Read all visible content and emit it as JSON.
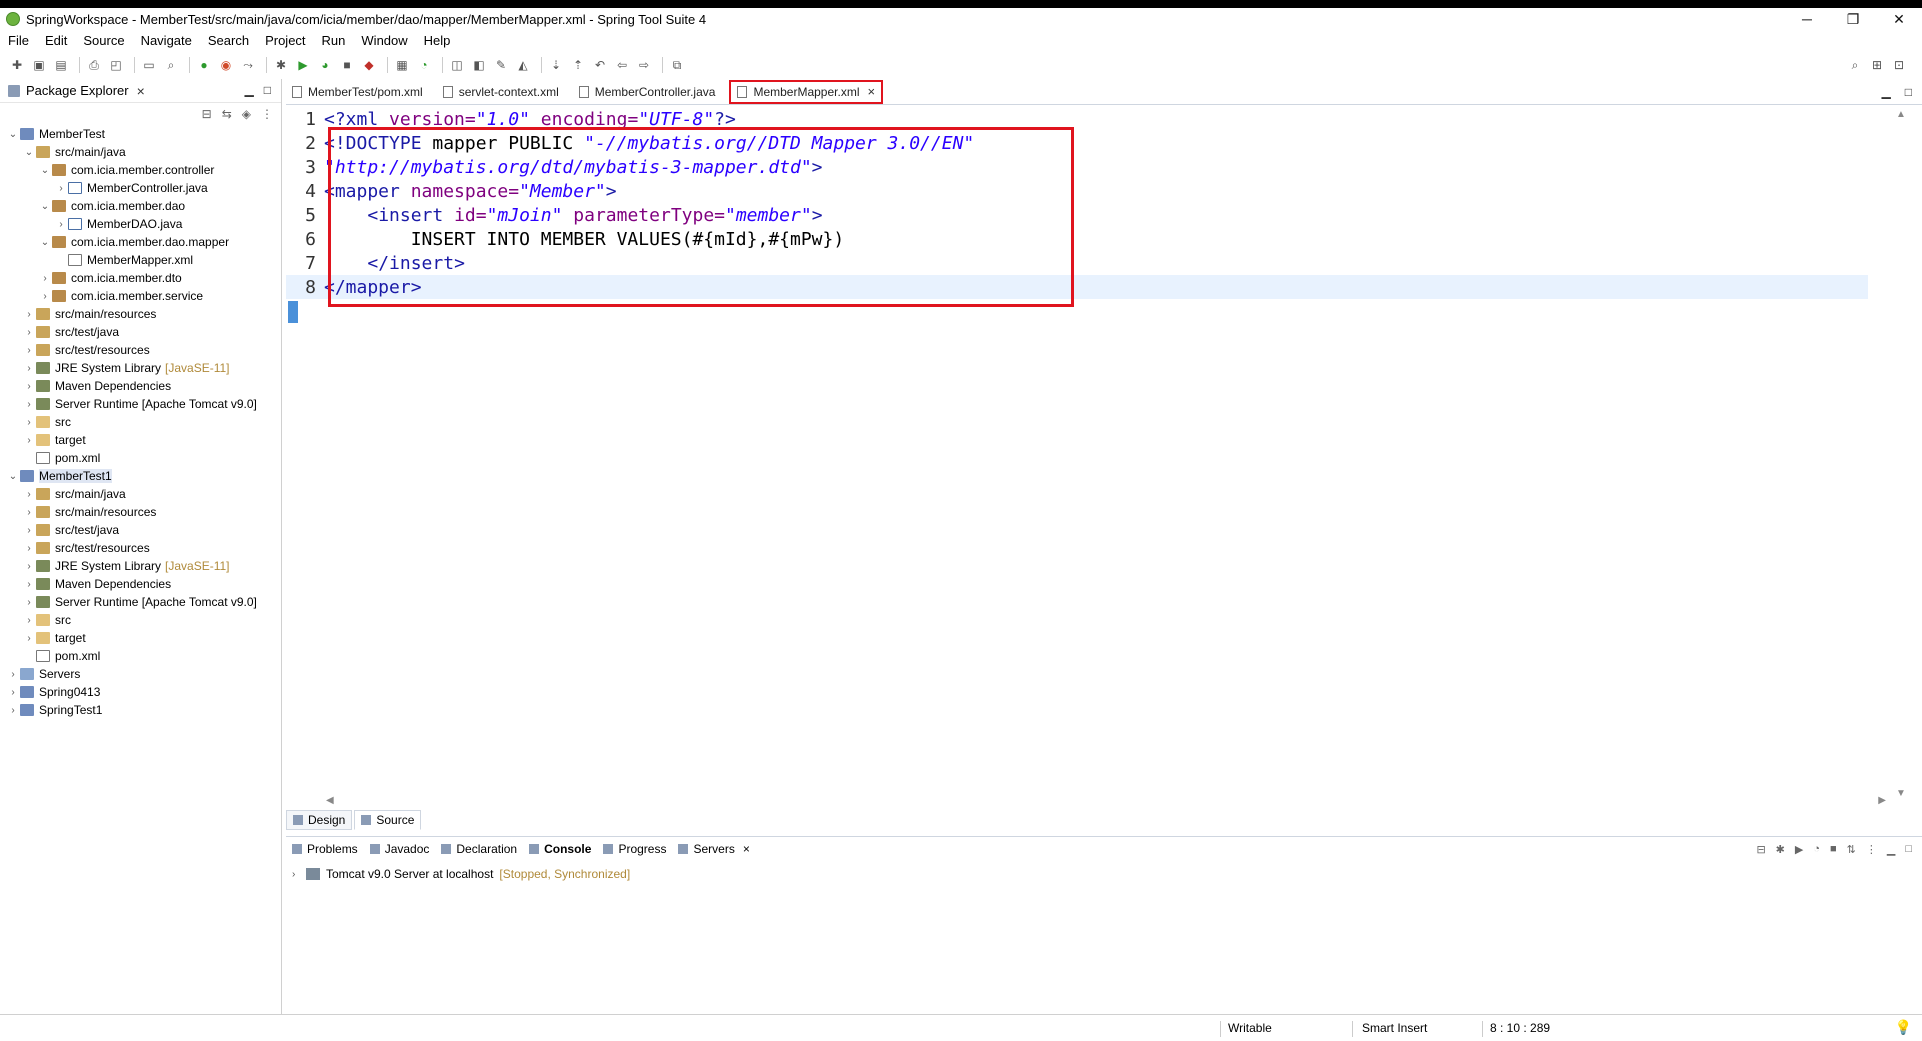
{
  "window": {
    "title": "SpringWorkspace - MemberTest/src/main/java/com/icia/member/dao/mapper/MemberMapper.xml - Spring Tool Suite 4",
    "minimize": "─",
    "maximize": "❐",
    "close": "✕"
  },
  "menu": [
    "File",
    "Edit",
    "Source",
    "Navigate",
    "Search",
    "Project",
    "Run",
    "Window",
    "Help"
  ],
  "package_explorer": {
    "title": "Package Explorer",
    "tree": [
      {
        "label": "MemberTest",
        "icon": "project-icon",
        "twisty": "⌄",
        "indent": 0
      },
      {
        "label": "src/main/java",
        "icon": "source-folder-icon",
        "twisty": "⌄",
        "indent": 1
      },
      {
        "label": "com.icia.member.controller",
        "icon": "package-icon",
        "twisty": "⌄",
        "indent": 2
      },
      {
        "label": "MemberController.java",
        "icon": "java-file-icon",
        "twisty": "›",
        "indent": 3
      },
      {
        "label": "com.icia.member.dao",
        "icon": "package-icon",
        "twisty": "⌄",
        "indent": 2
      },
      {
        "label": "MemberDAO.java",
        "icon": "java-file-icon",
        "twisty": "›",
        "indent": 3
      },
      {
        "label": "com.icia.member.dao.mapper",
        "icon": "package-icon",
        "twisty": "⌄",
        "indent": 2
      },
      {
        "label": "MemberMapper.xml",
        "icon": "xml-file-icon",
        "twisty": "",
        "indent": 3
      },
      {
        "label": "com.icia.member.dto",
        "icon": "package-icon",
        "twisty": "›",
        "indent": 2
      },
      {
        "label": "com.icia.member.service",
        "icon": "package-icon",
        "twisty": "›",
        "indent": 2
      },
      {
        "label": "src/main/resources",
        "icon": "source-folder-icon",
        "twisty": "›",
        "indent": 1
      },
      {
        "label": "src/test/java",
        "icon": "source-folder-icon",
        "twisty": "›",
        "indent": 1
      },
      {
        "label": "src/test/resources",
        "icon": "source-folder-icon",
        "twisty": "›",
        "indent": 1
      },
      {
        "label": "JRE System Library",
        "decoration": "[JavaSE-11]",
        "icon": "library-icon",
        "twisty": "›",
        "indent": 1
      },
      {
        "label": "Maven Dependencies",
        "icon": "library-icon",
        "twisty": "›",
        "indent": 1
      },
      {
        "label": "Server Runtime [Apache Tomcat v9.0]",
        "icon": "library-icon",
        "twisty": "›",
        "indent": 1
      },
      {
        "label": "src",
        "icon": "folder-icon",
        "twisty": "›",
        "indent": 1
      },
      {
        "label": "target",
        "icon": "folder-icon",
        "twisty": "›",
        "indent": 1
      },
      {
        "label": "pom.xml",
        "icon": "xml-file-icon",
        "twisty": "",
        "indent": 1
      },
      {
        "label": "MemberTest1",
        "icon": "project-icon",
        "twisty": "⌄",
        "indent": 0,
        "selected": true
      },
      {
        "label": "src/main/java",
        "icon": "source-folder-icon",
        "twisty": "›",
        "indent": 1
      },
      {
        "label": "src/main/resources",
        "icon": "source-folder-icon",
        "twisty": "›",
        "indent": 1
      },
      {
        "label": "src/test/java",
        "icon": "source-folder-icon",
        "twisty": "›",
        "indent": 1
      },
      {
        "label": "src/test/resources",
        "icon": "source-folder-icon",
        "twisty": "›",
        "indent": 1
      },
      {
        "label": "JRE System Library",
        "decoration": "[JavaSE-11]",
        "icon": "library-icon",
        "twisty": "›",
        "indent": 1
      },
      {
        "label": "Maven Dependencies",
        "icon": "library-icon",
        "twisty": "›",
        "indent": 1
      },
      {
        "label": "Server Runtime [Apache Tomcat v9.0]",
        "icon": "library-icon",
        "twisty": "›",
        "indent": 1
      },
      {
        "label": "src",
        "icon": "folder-icon",
        "twisty": "›",
        "indent": 1
      },
      {
        "label": "target",
        "icon": "folder-icon",
        "twisty": "›",
        "indent": 1
      },
      {
        "label": "pom.xml",
        "icon": "xml-file-icon",
        "twisty": "",
        "indent": 1
      },
      {
        "label": "Servers",
        "icon": "servers-icon",
        "twisty": "›",
        "indent": 0
      },
      {
        "label": "Spring0413",
        "icon": "project-icon",
        "twisty": "›",
        "indent": 0
      },
      {
        "label": "SpringTest1",
        "icon": "project-icon",
        "twisty": "›",
        "indent": 0
      }
    ]
  },
  "editor": {
    "tabs": [
      {
        "label": "MemberTest/pom.xml",
        "active": false
      },
      {
        "label": "servlet-context.xml",
        "active": false
      },
      {
        "label": "MemberController.java",
        "active": false
      },
      {
        "label": "MemberMapper.xml",
        "active": true
      }
    ],
    "lines": [
      {
        "num": "1",
        "text": "<?xml version=\"1.0\" encoding=\"UTF-8\"?>"
      },
      {
        "num": "2",
        "text": "<!DOCTYPE mapper PUBLIC \"-//mybatis.org//DTD Mapper 3.0//EN\""
      },
      {
        "num": "3",
        "text": "\"http://mybatis.org/dtd/mybatis-3-mapper.dtd\">"
      },
      {
        "num": "4",
        "text": "<mapper namespace=\"Member\">"
      },
      {
        "num": "5",
        "text": "    <insert id=\"mJoin\" parameterType=\"member\">"
      },
      {
        "num": "6",
        "text": "        INSERT INTO MEMBER VALUES(#{mId},#{mPw})"
      },
      {
        "num": "7",
        "text": "    </insert>"
      },
      {
        "num": "8",
        "text": "</mapper>"
      }
    ],
    "bottom_tabs": [
      "Design",
      "Source"
    ]
  },
  "bottom_views": {
    "tabs": [
      "Problems",
      "Javadoc",
      "Declaration",
      "Console",
      "Progress",
      "Servers"
    ],
    "active_tab": "Console",
    "server_name": "Tomcat v9.0 Server at localhost",
    "server_status": "[Stopped, Synchronized]"
  },
  "status_bar": {
    "mode": "Writable",
    "insert": "Smart Insert",
    "position": "8 : 10 : 289"
  },
  "colors": {
    "highlight_box": "#e0141e",
    "tag": "#1a1aa6",
    "string": "#2a00ff"
  }
}
